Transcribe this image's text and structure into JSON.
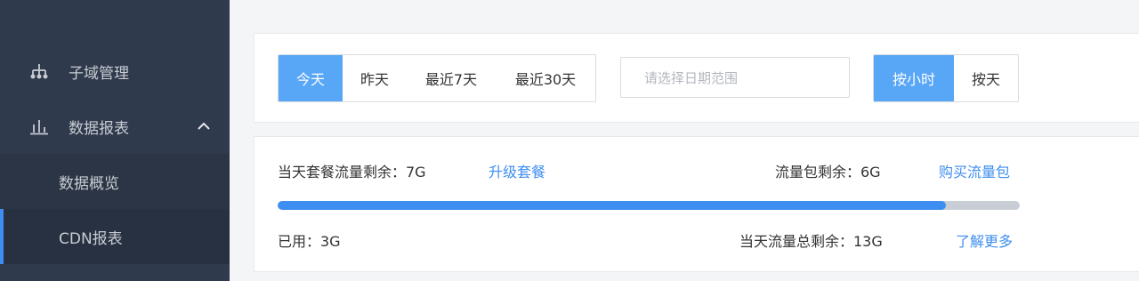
{
  "sidebar": {
    "items": [
      {
        "label": "子域管理",
        "icon": "sitemap-icon"
      },
      {
        "label": "数据报表",
        "icon": "bar-chart-icon",
        "expanded": true
      },
      {
        "label": "数据概览"
      },
      {
        "label": "CDN报表",
        "active": true
      }
    ]
  },
  "filter": {
    "range_buttons": [
      "今天",
      "昨天",
      "最近7天",
      "最近30天"
    ],
    "active_range": "今天",
    "date_placeholder": "请选择日期范围",
    "granularity_buttons": [
      "按小时",
      "按天"
    ],
    "active_granularity": "按小时"
  },
  "usage": {
    "plan_remaining": "当天套餐流量剩余：7G",
    "upgrade_link": "升级套餐",
    "package_remaining": "流量包剩余：6G",
    "buy_link": "购买流量包",
    "used": "已用：3G",
    "total_remaining": "当天流量总剩余：13G",
    "learn_more_link": "了解更多",
    "progress_fraction": 0.9
  },
  "colors": {
    "sidebar_bg": "#2f3a4c",
    "accent": "#3d8ef0",
    "active_button": "#58a6f6"
  }
}
